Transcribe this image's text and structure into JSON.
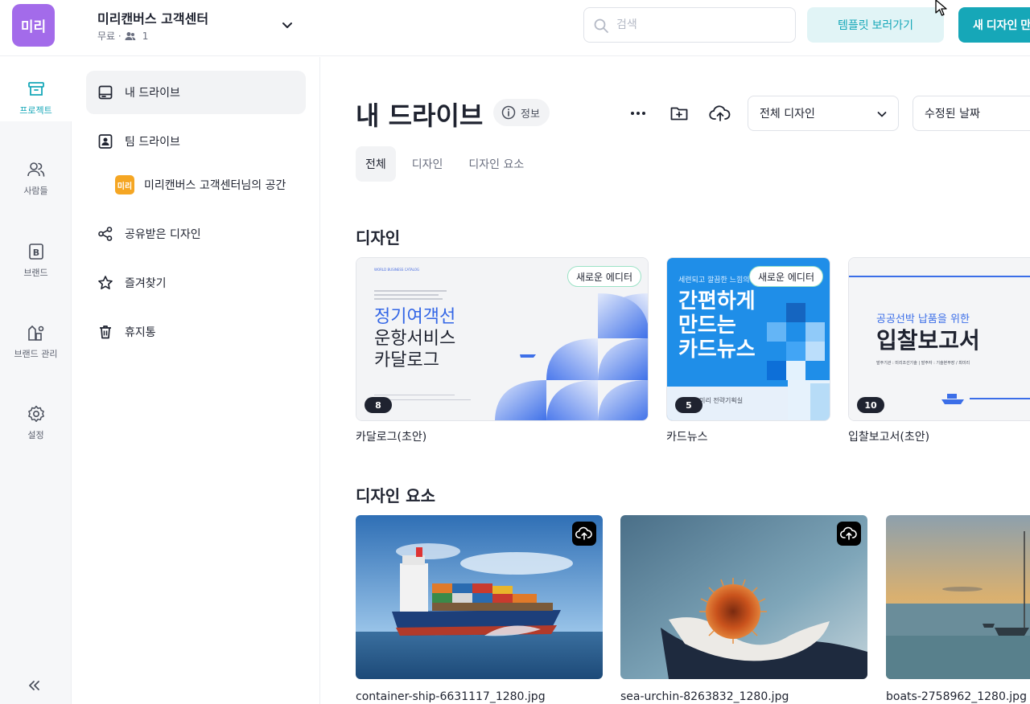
{
  "header": {
    "logo_text": "미리",
    "team_name": "미리캔버스 고객센터",
    "plan": "무료 ·",
    "member_count": "1",
    "search_placeholder": "검색",
    "template_button": "템플릿 보러가기",
    "new_design_button": "새 디자인 만들기"
  },
  "rail": {
    "items": [
      {
        "label": "프로젝트",
        "icon": "archive-icon"
      },
      {
        "label": "사람들",
        "icon": "people-icon"
      },
      {
        "label": "브랜드",
        "icon": "brand-icon"
      },
      {
        "label": "브랜드 관리",
        "icon": "brand-manage-icon"
      },
      {
        "label": "설정",
        "icon": "gear-icon"
      }
    ]
  },
  "sidebar": {
    "items": [
      {
        "label": "내 드라이브",
        "icon": "drive-icon"
      },
      {
        "label": "팀 드라이브",
        "icon": "team-drive-icon"
      },
      {
        "label": "미리캔버스 고객센터님의 공간",
        "badge": "미리"
      },
      {
        "label": "공유받은 디자인",
        "icon": "share-icon"
      },
      {
        "label": "즐겨찾기",
        "icon": "star-icon"
      },
      {
        "label": "휴지통",
        "icon": "trash-icon"
      }
    ]
  },
  "main": {
    "title": "내 드라이브",
    "info_label": "정보",
    "filter_type": "전체 디자인",
    "sort_by": "수정된 날짜",
    "tabs": [
      "전체",
      "디자인",
      "디자인 요소"
    ],
    "designs_section": "디자인",
    "elements_section": "디자인 요소",
    "designs": [
      {
        "name": "카달로그(초안)",
        "count": "8",
        "badge": "새로운 에디터",
        "thumb": {
          "small_header": "WORLD BUSINESS CATALOG",
          "line1": "정기여객선",
          "line2": "운항서비스",
          "line3": "카달로그"
        }
      },
      {
        "name": "카드뉴스",
        "count": "5",
        "badge": "새로운 에디터",
        "thumb": {
          "small_header": "세련되고 깔끔한 느낌의",
          "line1": "간편하게",
          "line2": "만드는",
          "line3": "카드뉴스",
          "footer": "미리 전략기획실"
        }
      },
      {
        "name": "입찰보고서(초안)",
        "count": "10",
        "thumb": {
          "small_header": "공공선박 납품을 위한",
          "line1": "입찰보고서",
          "footer": "발주기관 : 미리조선기술  |  발주자 : 기술본부장 / 최미리"
        }
      }
    ],
    "elements": [
      {
        "name": "container-ship-6631117_1280.jpg"
      },
      {
        "name": "sea-urchin-8263832_1280.jpg"
      },
      {
        "name": "boats-2758962_1280.jpg"
      }
    ]
  },
  "colors": {
    "accent": "#16a7b8",
    "logo": "#a36bea",
    "team_badge": "#f5a623"
  }
}
